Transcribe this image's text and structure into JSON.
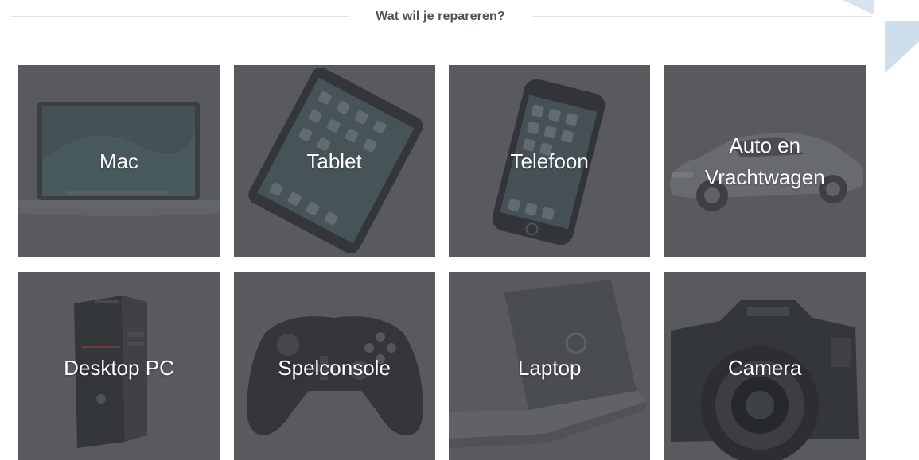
{
  "section": {
    "heading": "Wat wil je repareren?"
  },
  "tiles": [
    {
      "label": "Mac",
      "icon": "macbook-image"
    },
    {
      "label": "Tablet",
      "icon": "tablet-image"
    },
    {
      "label": "Telefoon",
      "icon": "phone-image"
    },
    {
      "label": "Auto en Vrachtwagen",
      "icon": "car-image"
    },
    {
      "label": "Desktop PC",
      "icon": "desktop-pc-image"
    },
    {
      "label": "Spelconsole",
      "icon": "game-controller-image"
    },
    {
      "label": "Laptop",
      "icon": "laptop-image"
    },
    {
      "label": "Camera",
      "icon": "camera-image"
    }
  ],
  "colors": {
    "tile_background": "#5f6164",
    "heading_text": "#4f5357",
    "accent_shape": "#d6e3f1"
  }
}
